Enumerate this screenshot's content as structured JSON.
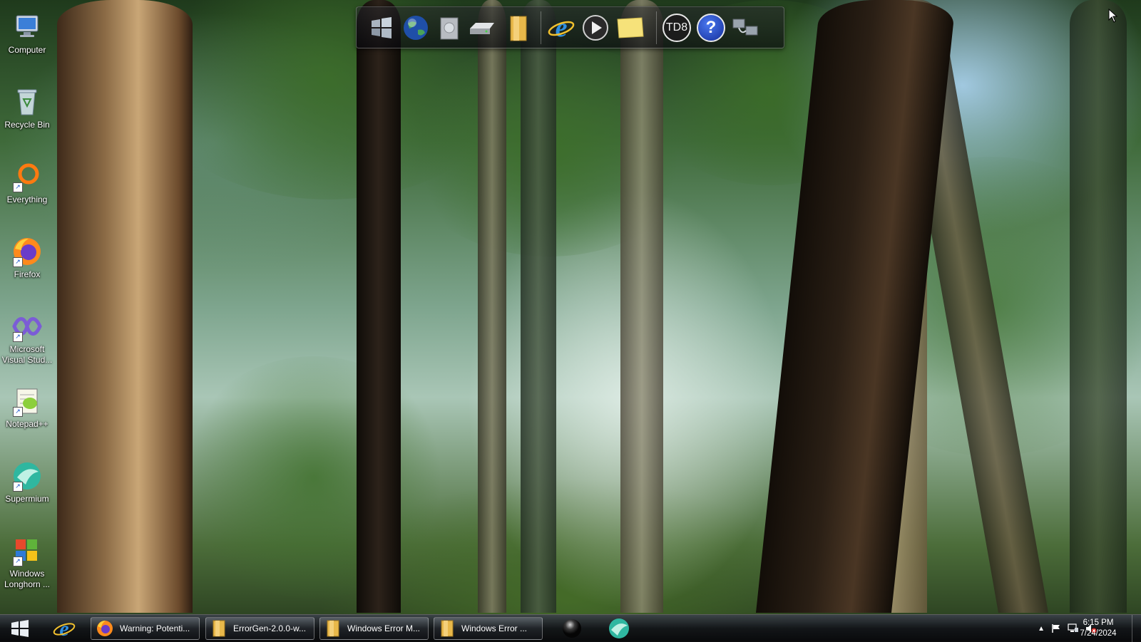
{
  "desktop": {
    "icons": [
      {
        "label": "Computer",
        "icon": "computer-icon"
      },
      {
        "label": "Recycle Bin",
        "icon": "recycle-bin-icon"
      },
      {
        "label": "Everything",
        "icon": "everything-search-icon"
      },
      {
        "label": "Firefox",
        "icon": "firefox-icon"
      },
      {
        "label": "Microsoft Visual Stud...",
        "icon": "visual-studio-icon"
      },
      {
        "label": "Notepad++",
        "icon": "notepad-plus-plus-icon"
      },
      {
        "label": "Supermium",
        "icon": "supermium-icon"
      },
      {
        "label": "Windows Longhorn ...",
        "icon": "windows-longhorn-icon"
      }
    ]
  },
  "dock": {
    "items": [
      {
        "icon": "windows-flag-icon"
      },
      {
        "icon": "globe-icon"
      },
      {
        "icon": "disc-drive-icon"
      },
      {
        "icon": "hard-drive-icon"
      },
      {
        "icon": "folder-icon"
      },
      {
        "icon": "internet-explorer-icon"
      },
      {
        "icon": "media-player-icon"
      },
      {
        "icon": "sticky-note-icon"
      },
      {
        "icon": "td8-icon",
        "label": "TD8"
      },
      {
        "icon": "help-icon",
        "label": "?"
      },
      {
        "icon": "network-icon"
      }
    ]
  },
  "taskbar": {
    "tasks": [
      {
        "label": "Warning: Potenti...",
        "icon": "firefox-icon"
      },
      {
        "label": "ErrorGen-2.0.0-w...",
        "icon": "folder-icon"
      },
      {
        "label": "Windows Error M...",
        "icon": "folder-icon"
      },
      {
        "label": "Windows Error ...",
        "icon": "folder-icon"
      }
    ],
    "tray_icons": [
      "show-hidden-icons-arrow",
      "action-center-flag-icon",
      "network-icon",
      "volume-muted-icon"
    ],
    "clock": {
      "time": "6:15 PM",
      "date": "7/24/2024"
    }
  }
}
